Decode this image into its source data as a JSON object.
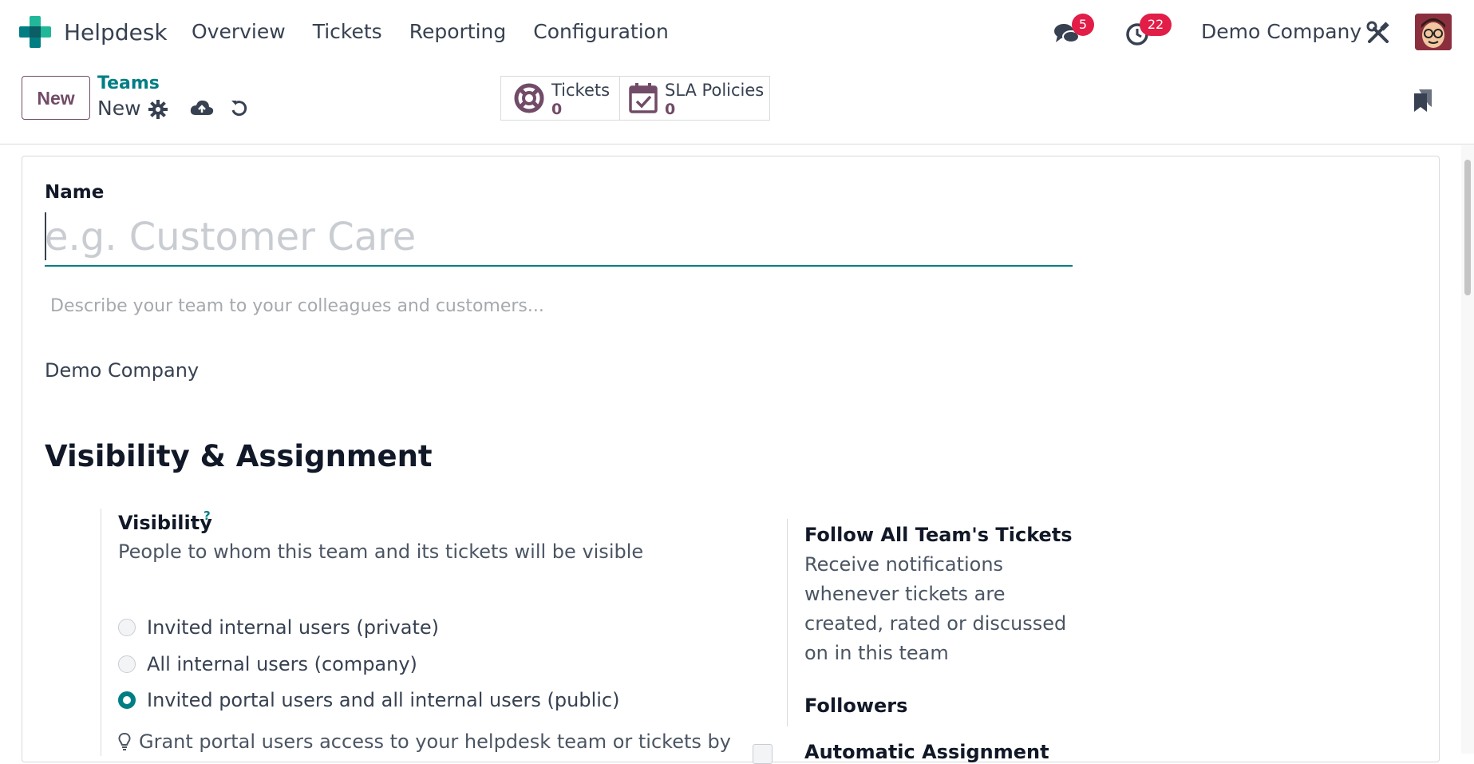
{
  "app": {
    "name": "Helpdesk",
    "logo_icon": "helpdesk-logo-icon",
    "brand_color": "#017e84"
  },
  "menu": {
    "items": [
      "Overview",
      "Tickets",
      "Reporting",
      "Configuration"
    ]
  },
  "systray": {
    "messages_icon": "chat-bubbles-icon",
    "messages_count": "5",
    "activities_icon": "clock-icon",
    "activities_count": "22",
    "company": "Demo Company",
    "debug_icon": "tools-icon",
    "avatar_icon": "user-avatar"
  },
  "control_panel": {
    "new_button": "New",
    "breadcrumb_parent": "Teams",
    "breadcrumb_current": "New",
    "settings_icon": "gear-icon",
    "save_icon": "cloud-upload-icon",
    "discard_icon": "undo-icon",
    "bookmark_icon": "bookmark-icon",
    "smart_buttons": [
      {
        "label": "Tickets",
        "value": "0",
        "icon": "lifebuoy-icon"
      },
      {
        "label": "SLA Policies",
        "value": "0",
        "icon": "calendar-check-icon"
      }
    ]
  },
  "form": {
    "name_label": "Name",
    "name_value": "",
    "name_placeholder": "e.g. Customer Care",
    "description_placeholder": "Describe your team to your colleagues and customers...",
    "company": "Demo Company",
    "section_title": "Visibility & Assignment",
    "visibility": {
      "label": "Visibility",
      "help_marker": "?",
      "help": "People to whom this team and its tickets will be visible",
      "options": [
        {
          "label": "Invited internal users (private)",
          "selected": false
        },
        {
          "label": "All internal users (company)",
          "selected": false
        },
        {
          "label": "Invited portal users and all internal users (public)",
          "selected": true
        }
      ],
      "tip_icon": "lightbulb-icon",
      "tip": "Grant portal users access to your helpdesk team or tickets by"
    },
    "follow": {
      "label": "Follow All Team's Tickets",
      "help": "Receive notifications whenever tickets are created, rated or discussed on in this team",
      "checked": false
    },
    "followers_label": "Followers",
    "auto_assignment_label": "Automatic Assignment"
  },
  "colors": {
    "primary": "#714b67",
    "accent": "#017e84",
    "badge": "#e11d48"
  }
}
